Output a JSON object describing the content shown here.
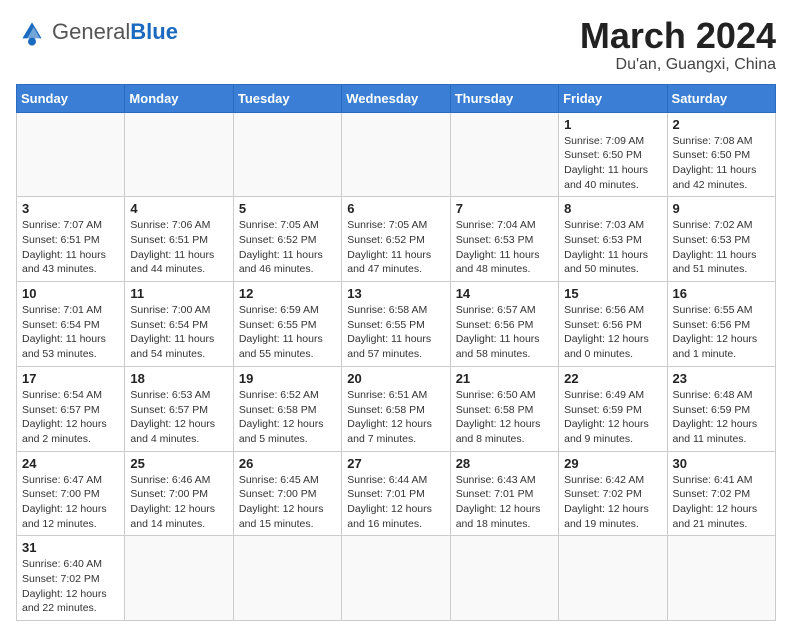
{
  "header": {
    "logo_general": "General",
    "logo_blue": "Blue",
    "month_title": "March 2024",
    "location": "Du'an, Guangxi, China"
  },
  "weekdays": [
    "Sunday",
    "Monday",
    "Tuesday",
    "Wednesday",
    "Thursday",
    "Friday",
    "Saturday"
  ],
  "weeks": [
    [
      {
        "day": "",
        "info": ""
      },
      {
        "day": "",
        "info": ""
      },
      {
        "day": "",
        "info": ""
      },
      {
        "day": "",
        "info": ""
      },
      {
        "day": "",
        "info": ""
      },
      {
        "day": "1",
        "info": "Sunrise: 7:09 AM\nSunset: 6:50 PM\nDaylight: 11 hours and 40 minutes."
      },
      {
        "day": "2",
        "info": "Sunrise: 7:08 AM\nSunset: 6:50 PM\nDaylight: 11 hours and 42 minutes."
      }
    ],
    [
      {
        "day": "3",
        "info": "Sunrise: 7:07 AM\nSunset: 6:51 PM\nDaylight: 11 hours and 43 minutes."
      },
      {
        "day": "4",
        "info": "Sunrise: 7:06 AM\nSunset: 6:51 PM\nDaylight: 11 hours and 44 minutes."
      },
      {
        "day": "5",
        "info": "Sunrise: 7:05 AM\nSunset: 6:52 PM\nDaylight: 11 hours and 46 minutes."
      },
      {
        "day": "6",
        "info": "Sunrise: 7:05 AM\nSunset: 6:52 PM\nDaylight: 11 hours and 47 minutes."
      },
      {
        "day": "7",
        "info": "Sunrise: 7:04 AM\nSunset: 6:53 PM\nDaylight: 11 hours and 48 minutes."
      },
      {
        "day": "8",
        "info": "Sunrise: 7:03 AM\nSunset: 6:53 PM\nDaylight: 11 hours and 50 minutes."
      },
      {
        "day": "9",
        "info": "Sunrise: 7:02 AM\nSunset: 6:53 PM\nDaylight: 11 hours and 51 minutes."
      }
    ],
    [
      {
        "day": "10",
        "info": "Sunrise: 7:01 AM\nSunset: 6:54 PM\nDaylight: 11 hours and 53 minutes."
      },
      {
        "day": "11",
        "info": "Sunrise: 7:00 AM\nSunset: 6:54 PM\nDaylight: 11 hours and 54 minutes."
      },
      {
        "day": "12",
        "info": "Sunrise: 6:59 AM\nSunset: 6:55 PM\nDaylight: 11 hours and 55 minutes."
      },
      {
        "day": "13",
        "info": "Sunrise: 6:58 AM\nSunset: 6:55 PM\nDaylight: 11 hours and 57 minutes."
      },
      {
        "day": "14",
        "info": "Sunrise: 6:57 AM\nSunset: 6:56 PM\nDaylight: 11 hours and 58 minutes."
      },
      {
        "day": "15",
        "info": "Sunrise: 6:56 AM\nSunset: 6:56 PM\nDaylight: 12 hours and 0 minutes."
      },
      {
        "day": "16",
        "info": "Sunrise: 6:55 AM\nSunset: 6:56 PM\nDaylight: 12 hours and 1 minute."
      }
    ],
    [
      {
        "day": "17",
        "info": "Sunrise: 6:54 AM\nSunset: 6:57 PM\nDaylight: 12 hours and 2 minutes."
      },
      {
        "day": "18",
        "info": "Sunrise: 6:53 AM\nSunset: 6:57 PM\nDaylight: 12 hours and 4 minutes."
      },
      {
        "day": "19",
        "info": "Sunrise: 6:52 AM\nSunset: 6:58 PM\nDaylight: 12 hours and 5 minutes."
      },
      {
        "day": "20",
        "info": "Sunrise: 6:51 AM\nSunset: 6:58 PM\nDaylight: 12 hours and 7 minutes."
      },
      {
        "day": "21",
        "info": "Sunrise: 6:50 AM\nSunset: 6:58 PM\nDaylight: 12 hours and 8 minutes."
      },
      {
        "day": "22",
        "info": "Sunrise: 6:49 AM\nSunset: 6:59 PM\nDaylight: 12 hours and 9 minutes."
      },
      {
        "day": "23",
        "info": "Sunrise: 6:48 AM\nSunset: 6:59 PM\nDaylight: 12 hours and 11 minutes."
      }
    ],
    [
      {
        "day": "24",
        "info": "Sunrise: 6:47 AM\nSunset: 7:00 PM\nDaylight: 12 hours and 12 minutes."
      },
      {
        "day": "25",
        "info": "Sunrise: 6:46 AM\nSunset: 7:00 PM\nDaylight: 12 hours and 14 minutes."
      },
      {
        "day": "26",
        "info": "Sunrise: 6:45 AM\nSunset: 7:00 PM\nDaylight: 12 hours and 15 minutes."
      },
      {
        "day": "27",
        "info": "Sunrise: 6:44 AM\nSunset: 7:01 PM\nDaylight: 12 hours and 16 minutes."
      },
      {
        "day": "28",
        "info": "Sunrise: 6:43 AM\nSunset: 7:01 PM\nDaylight: 12 hours and 18 minutes."
      },
      {
        "day": "29",
        "info": "Sunrise: 6:42 AM\nSunset: 7:02 PM\nDaylight: 12 hours and 19 minutes."
      },
      {
        "day": "30",
        "info": "Sunrise: 6:41 AM\nSunset: 7:02 PM\nDaylight: 12 hours and 21 minutes."
      }
    ],
    [
      {
        "day": "31",
        "info": "Sunrise: 6:40 AM\nSunset: 7:02 PM\nDaylight: 12 hours and 22 minutes."
      },
      {
        "day": "",
        "info": ""
      },
      {
        "day": "",
        "info": ""
      },
      {
        "day": "",
        "info": ""
      },
      {
        "day": "",
        "info": ""
      },
      {
        "day": "",
        "info": ""
      },
      {
        "day": "",
        "info": ""
      }
    ]
  ]
}
